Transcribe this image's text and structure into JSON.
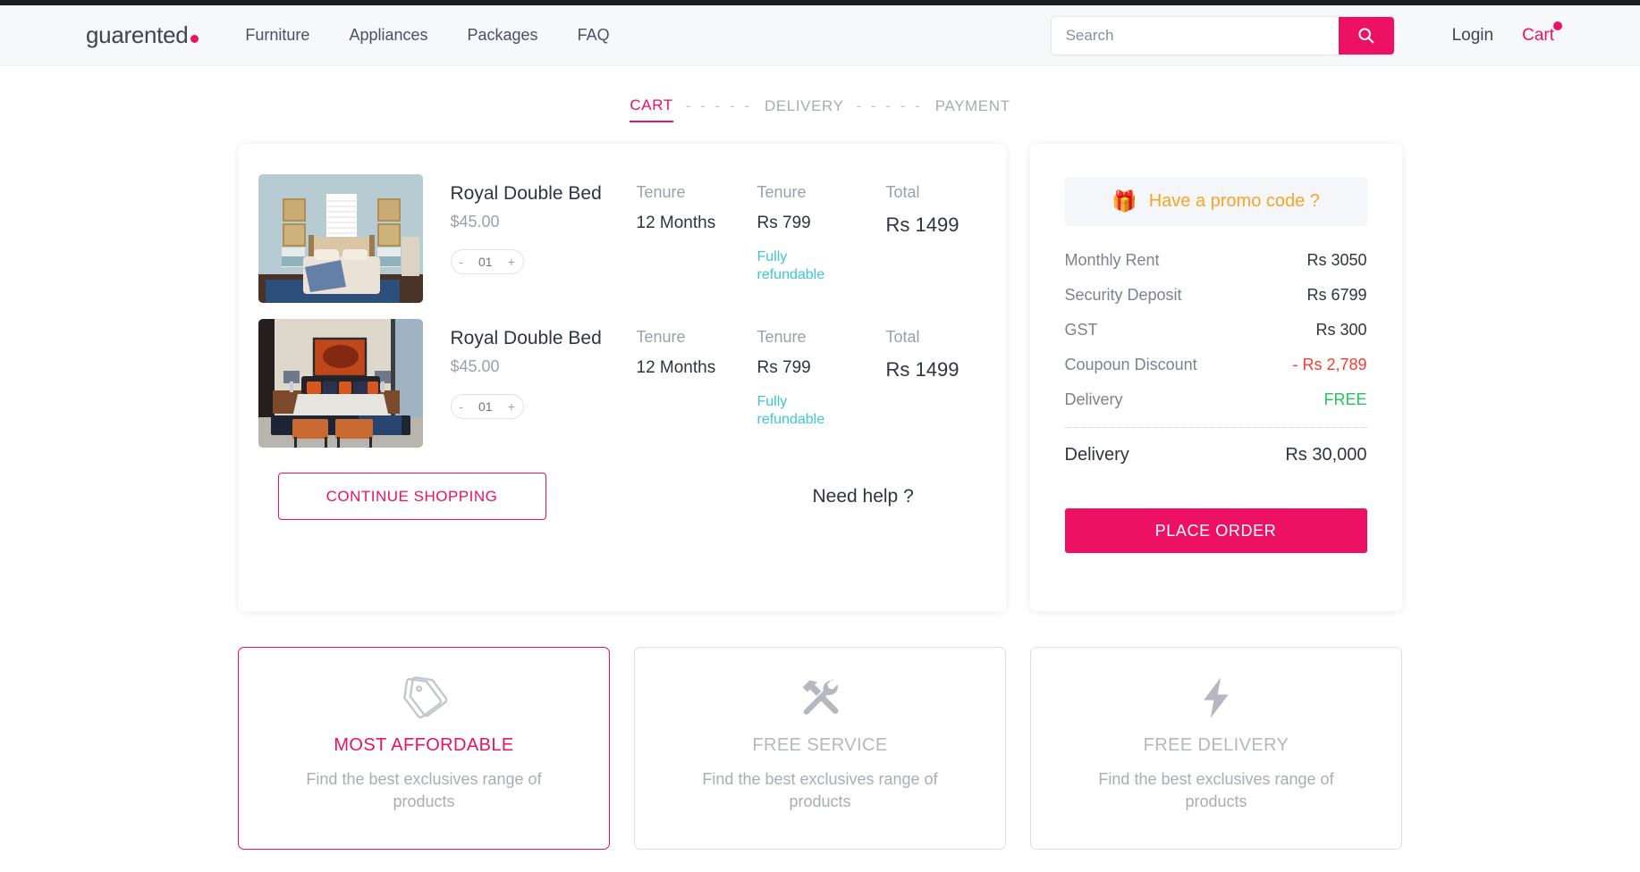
{
  "header": {
    "brand": "guarented",
    "nav": [
      {
        "label": "Furniture"
      },
      {
        "label": "Appliances"
      },
      {
        "label": "Packages"
      },
      {
        "label": "FAQ"
      }
    ],
    "search": {
      "placeholder": "Search",
      "value": "",
      "icon": "search-icon"
    },
    "login_label": "Login",
    "cart_label": "Cart",
    "cart_has_badge": true,
    "accent_color": "#ec1162"
  },
  "stepper": {
    "steps": [
      {
        "label": "CART",
        "active": true
      },
      {
        "label": "DELIVERY",
        "active": false
      },
      {
        "label": "PAYMENT",
        "active": false
      }
    ],
    "separator": "- - - - -"
  },
  "cart": {
    "columns": {
      "tenure_label": "Tenure",
      "deposit_label": "Tenure",
      "total_label": "Total"
    },
    "items": [
      {
        "name": "Royal Double Bed",
        "price": "$45.00",
        "quantity": "01",
        "decrement": "-",
        "increment": "+",
        "tenure_label": "Tenure",
        "tenure_value": "12 Months",
        "deposit_label": "Tenure",
        "deposit_value": "Rs 799",
        "refund_note": "Fully refundable",
        "total_label": "Total",
        "total_value": "Rs 1499",
        "image_name": "royal-double-bed-blue-room"
      },
      {
        "name": "Royal Double Bed",
        "price": "$45.00",
        "quantity": "01",
        "decrement": "-",
        "increment": "+",
        "tenure_label": "Tenure",
        "tenure_value": "12 Months",
        "deposit_label": "Tenure",
        "deposit_value": "Rs 799",
        "refund_note": "Fully refundable",
        "total_label": "Total",
        "total_value": "Rs 1499",
        "image_name": "royal-double-bed-orange-room"
      }
    ],
    "continue_label": "CONTINUE SHOPPING",
    "need_help_label": "Need help ?"
  },
  "summary": {
    "promo_label": "Have a promo code ?",
    "promo_icon": "gift-icon",
    "promo_color": "#f5a623",
    "rows": [
      {
        "label": "Monthly Rent",
        "value": "Rs 3050",
        "style": "normal"
      },
      {
        "label": "Security Deposit",
        "value": "Rs 6799",
        "style": "normal"
      },
      {
        "label": "GST",
        "value": "Rs 300",
        "style": "normal"
      },
      {
        "label": "Coupoun Discount",
        "value": "- Rs 2,789",
        "style": "discount"
      },
      {
        "label": "Delivery",
        "value": "FREE",
        "style": "free"
      }
    ],
    "total": {
      "label": "Delivery",
      "value": "Rs 30,000"
    },
    "place_order_label": "PLACE ORDER"
  },
  "features": [
    {
      "title": "MOST AFFORDABLE",
      "desc": "Find the best exclusives range of products",
      "icon": "price-tag-icon",
      "active": true
    },
    {
      "title": "FREE SERVICE",
      "desc": "Find the best exclusives range of products",
      "icon": "tools-icon",
      "active": false
    },
    {
      "title": "FREE DELIVERY",
      "desc": "Find the best exclusives range of products",
      "icon": "lightning-bolt-icon",
      "active": false
    }
  ]
}
